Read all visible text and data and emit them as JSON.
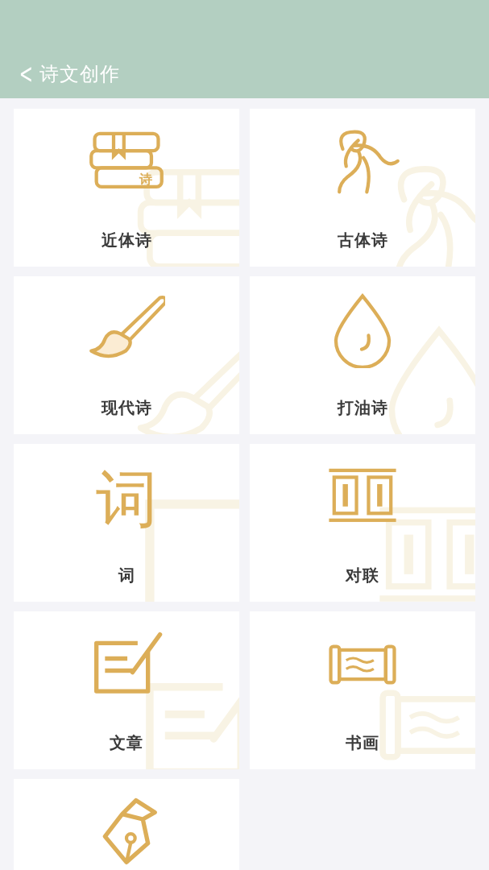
{
  "header": {
    "back_icon": "<",
    "title": "诗文创作"
  },
  "cards": [
    {
      "kind": "books",
      "icon_text": "诗",
      "label": "近体诗"
    },
    {
      "kind": "dancer",
      "label": "古体诗"
    },
    {
      "kind": "brush",
      "label": "现代诗"
    },
    {
      "kind": "drop",
      "label": "打油诗"
    },
    {
      "kind": "glyph",
      "icon_text": "词",
      "label": "词"
    },
    {
      "kind": "couplet",
      "label": "对联"
    },
    {
      "kind": "edit",
      "label": "文章"
    },
    {
      "kind": "scroll",
      "label": "书画"
    },
    {
      "kind": "pen"
    }
  ]
}
